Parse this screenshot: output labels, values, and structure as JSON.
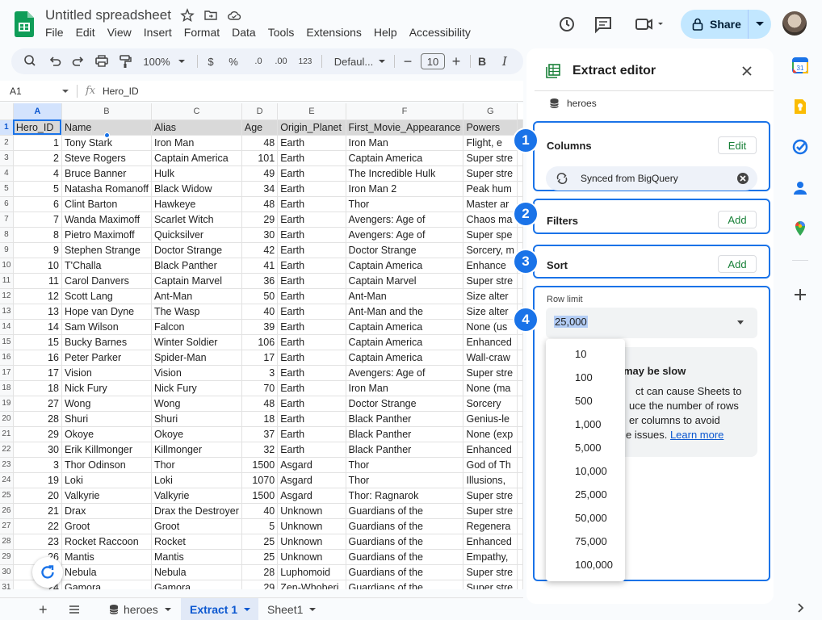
{
  "app": {
    "title": "Untitled spreadsheet",
    "menu": [
      "File",
      "Edit",
      "View",
      "Insert",
      "Format",
      "Data",
      "Tools",
      "Extensions",
      "Help",
      "Accessibility"
    ],
    "share_label": "Share"
  },
  "toolbar": {
    "zoom": "100%",
    "currency": "$",
    "percent": "%",
    "decrease_decimal": ".0",
    "increase_decimal": ".00",
    "number_format": "123",
    "font": "Defaul...",
    "font_size": "10",
    "bold": "B",
    "italic": "I"
  },
  "formula_bar": {
    "cell_ref": "A1",
    "value": "Hero_ID"
  },
  "grid": {
    "column_letters": [
      "A",
      "B",
      "C",
      "D",
      "E",
      "F",
      "G"
    ],
    "rows": [
      [
        "Hero_ID",
        "Name",
        "Alias",
        "Age",
        "Origin_Planet",
        "First_Movie_Appearance",
        "Powers"
      ],
      [
        "1",
        "Tony Stark",
        "Iron Man",
        "48",
        "Earth",
        "Iron Man",
        "Flight, e"
      ],
      [
        "2",
        "Steve Rogers",
        "Captain America",
        "101",
        "Earth",
        "Captain America",
        "Super stre"
      ],
      [
        "4",
        "Bruce Banner",
        "Hulk",
        "49",
        "Earth",
        "The Incredible Hulk",
        "Super stre"
      ],
      [
        "5",
        "Natasha Romanoff",
        "Black Widow",
        "34",
        "Earth",
        "Iron Man 2",
        "Peak hum"
      ],
      [
        "6",
        "Clint Barton",
        "Hawkeye",
        "48",
        "Earth",
        "Thor",
        "Master ar"
      ],
      [
        "7",
        "Wanda Maximoff",
        "Scarlet Witch",
        "29",
        "Earth",
        "Avengers: Age of",
        "Chaos ma"
      ],
      [
        "8",
        "Pietro Maximoff",
        "Quicksilver",
        "30",
        "Earth",
        "Avengers: Age of",
        "Super spe"
      ],
      [
        "9",
        "Stephen Strange",
        "Doctor Strange",
        "42",
        "Earth",
        "Doctor Strange",
        "Sorcery, m"
      ],
      [
        "10",
        "T'Challa",
        "Black Panther",
        "41",
        "Earth",
        "Captain America",
        "Enhance"
      ],
      [
        "11",
        "Carol Danvers",
        "Captain Marvel",
        "36",
        "Earth",
        "Captain Marvel",
        "Super stre"
      ],
      [
        "12",
        "Scott Lang",
        "Ant-Man",
        "50",
        "Earth",
        "Ant-Man",
        "Size alter"
      ],
      [
        "13",
        "Hope van Dyne",
        "The Wasp",
        "40",
        "Earth",
        "Ant-Man and the",
        "Size alter"
      ],
      [
        "14",
        "Sam Wilson",
        "Falcon",
        "39",
        "Earth",
        "Captain America",
        "None (us"
      ],
      [
        "15",
        "Bucky Barnes",
        "Winter Soldier",
        "106",
        "Earth",
        "Captain America",
        "Enhanced"
      ],
      [
        "16",
        "Peter Parker",
        "Spider-Man",
        "17",
        "Earth",
        "Captain America",
        "Wall-craw"
      ],
      [
        "17",
        "Vision",
        "Vision",
        "3",
        "Earth",
        "Avengers: Age of",
        "Super stre"
      ],
      [
        "18",
        "Nick Fury",
        "Nick Fury",
        "70",
        "Earth",
        "Iron Man",
        "None (ma"
      ],
      [
        "27",
        "Wong",
        "Wong",
        "48",
        "Earth",
        "Doctor Strange",
        "Sorcery"
      ],
      [
        "28",
        "Shuri",
        "Shuri",
        "18",
        "Earth",
        "Black Panther",
        "Genius-le"
      ],
      [
        "29",
        "Okoye",
        "Okoye",
        "37",
        "Earth",
        "Black Panther",
        "None (exp"
      ],
      [
        "30",
        "Erik Killmonger",
        "Killmonger",
        "32",
        "Earth",
        "Black Panther",
        "Enhanced"
      ],
      [
        "3",
        "Thor Odinson",
        "Thor",
        "1500",
        "Asgard",
        "Thor",
        "God of Th"
      ],
      [
        "19",
        "Loki",
        "Loki",
        "1070",
        "Asgard",
        "Thor",
        "Illusions,"
      ],
      [
        "20",
        "Valkyrie",
        "Valkyrie",
        "1500",
        "Asgard",
        "Thor: Ragnarok",
        "Super stre"
      ],
      [
        "21",
        "Drax",
        "Drax the Destroyer",
        "40",
        "Unknown",
        "Guardians of the",
        "Super stre"
      ],
      [
        "22",
        "Groot",
        "Groot",
        "5",
        "Unknown",
        "Guardians of the",
        "Regenera"
      ],
      [
        "23",
        "Rocket Raccoon",
        "Rocket",
        "25",
        "Unknown",
        "Guardians of the",
        "Enhanced"
      ],
      [
        "26",
        "Mantis",
        "Mantis",
        "25",
        "Unknown",
        "Guardians of the",
        "Empathy,"
      ],
      [
        "25",
        "Nebula",
        "Nebula",
        "28",
        "Luphomoid",
        "Guardians of the",
        "Super stre"
      ],
      [
        "24",
        "Gamora",
        "Gamora",
        "29",
        "Zen-Whoberi",
        "Guardians of the",
        "Super stre"
      ]
    ]
  },
  "sheet_tabs": {
    "tab1": "heroes",
    "tab2": "Extract 1",
    "tab3": "Sheet1"
  },
  "extract_editor": {
    "title": "Extract editor",
    "source": "heroes",
    "badges": [
      "1",
      "2",
      "3",
      "4"
    ],
    "columns": {
      "title": "Columns",
      "button": "Edit",
      "chip": "Synced from BigQuery"
    },
    "filters": {
      "title": "Filters",
      "button": "Add"
    },
    "sort": {
      "title": "Sort",
      "button": "Add"
    },
    "row_limit": {
      "label": "Row limit",
      "value": "25,000",
      "options": [
        "10",
        "100",
        "500",
        "1,000",
        "5,000",
        "10,000",
        "25,000",
        "50,000",
        "75,000",
        "100,000"
      ],
      "warning_title": "may be slow",
      "warning_lines": [
        "ct can cause Sheets to",
        "uce the number of rows",
        "er columns to avoid",
        "e issues."
      ],
      "learn_more": "Learn more"
    }
  },
  "colors": {
    "accent": "#1a73e8",
    "share_bg": "#c2e7ff",
    "sheets_green": "#0f9d58",
    "active_tab_text": "#0b57d0",
    "add_button_text": "#188038"
  },
  "icons": [
    "sheets-logo-icon",
    "star-icon",
    "folder-icon",
    "cloud-icon",
    "history-icon",
    "comment-icon",
    "video-icon",
    "lock-icon",
    "search-icon",
    "undo-icon",
    "redo-icon",
    "print-icon",
    "paint-format-icon",
    "close-icon",
    "database-icon",
    "sync-icon",
    "refresh-icon",
    "calendar-icon",
    "keep-icon",
    "tasks-icon",
    "contacts-icon",
    "maps-icon",
    "plus-icon"
  ]
}
